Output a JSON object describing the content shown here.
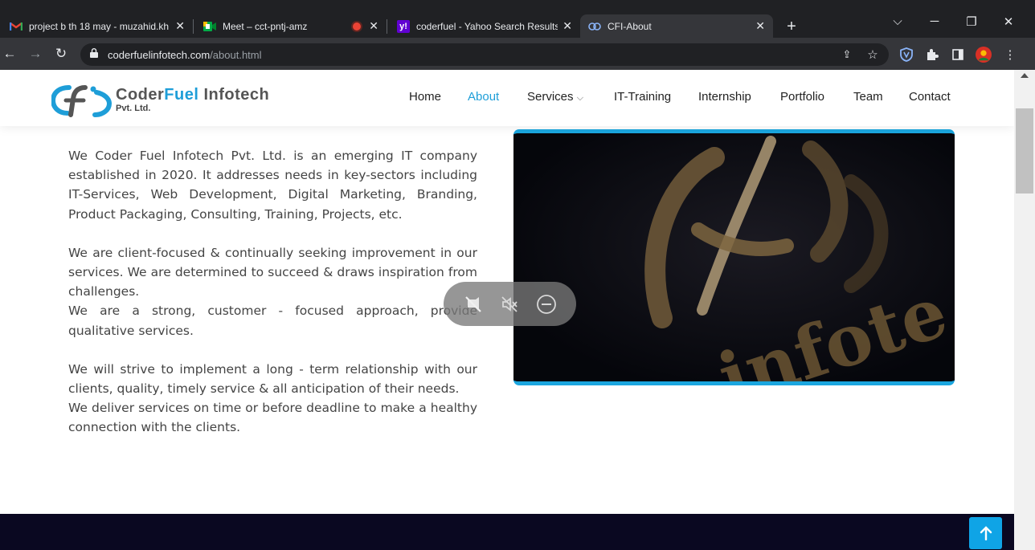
{
  "browser": {
    "tabs": [
      {
        "title": "project b th 18 may - muzahid.kh",
        "icon": "gmail-icon",
        "active": false
      },
      {
        "title": "Meet – cct-pntj-amz",
        "icon": "meet-icon",
        "active": false
      },
      {
        "title": "coderfuel - Yahoo Search Results",
        "icon": "yahoo-icon",
        "active": false
      },
      {
        "title": "CFI-About",
        "icon": "cfi-icon",
        "active": true
      }
    ],
    "url_host": "coderfuelinfotech.com",
    "url_path": "/about.html"
  },
  "site": {
    "logo_word1": "Coder",
    "logo_word2": "Fuel",
    "logo_word3": " Infotech",
    "logo_sub": "Pvt. Ltd.",
    "nav": [
      {
        "label": "Home",
        "active": false
      },
      {
        "label": "About",
        "active": true
      },
      {
        "label": "Services",
        "active": false,
        "dropdown": true
      },
      {
        "label": "IT-Training",
        "active": false
      },
      {
        "label": "Internship",
        "active": false
      },
      {
        "label": "Portfolio",
        "active": false
      },
      {
        "label": "Team",
        "active": false
      },
      {
        "label": "Contact",
        "active": false
      }
    ]
  },
  "about": {
    "p1": "We Coder Fuel Infotech Pvt. Ltd. is an emerging IT company established in 2020. It addresses needs in key-sectors including IT-Services, Web Development, Digital Marketing, Branding, Product Packaging, Consulting, Training, Projects, etc.",
    "p2": "We are client-focused & continually seeking improvement in our services. We are determined to succeed & draws inspiration from challenges.",
    "p3": "We are a strong, customer - focused approach, provide qualitative services.",
    "p4": "We will strive to implement a long - term relationship with our clients, quality, timely service & all anticipation of their needs.",
    "p5": "We deliver services on time or before deadline to make a healthy connection with the clients."
  },
  "colors": {
    "accent": "#1e9ed8",
    "footer": "#0a0821",
    "to_top": "#0fa4e6"
  }
}
